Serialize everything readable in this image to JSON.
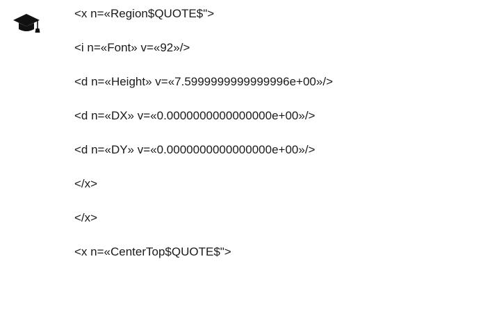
{
  "icon": "graduation-cap-icon",
  "lines": [
    "<x n=«Region$QUOTE$\">",
    "<i n=«Font» v=«92»/>",
    "<d n=«Height» v=«7.5999999999999996e+00»/>",
    "<d n=«DX» v=«0.0000000000000000e+00»/>",
    "<d n=«DY» v=«0.0000000000000000e+00»/>",
    "</x>",
    "</x>",
    "<x n=«CenterTop$QUOTE$\">"
  ]
}
